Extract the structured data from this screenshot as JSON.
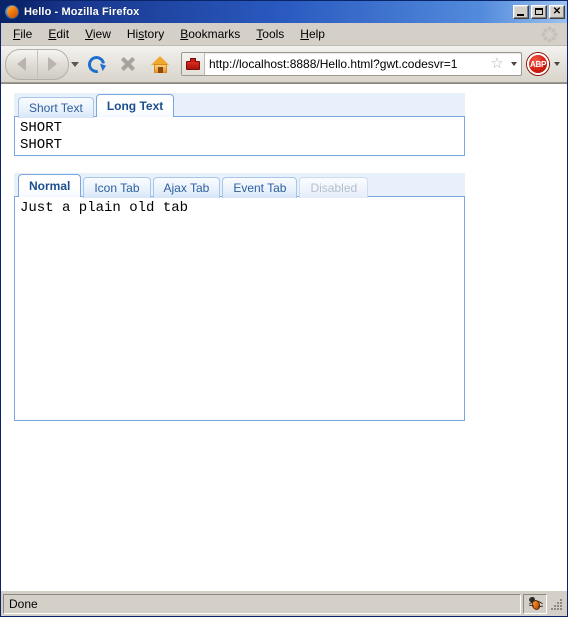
{
  "window": {
    "title": "Hello - Mozilla Firefox",
    "icon": "firefox-icon",
    "minimize_label": "–",
    "maximize_label": "□",
    "close_label": "✕"
  },
  "menubar": {
    "items": [
      {
        "pre": "",
        "key": "F",
        "post": "ile",
        "name": "menu-file"
      },
      {
        "pre": "",
        "key": "E",
        "post": "dit",
        "name": "menu-edit"
      },
      {
        "pre": "",
        "key": "V",
        "post": "iew",
        "name": "menu-view"
      },
      {
        "pre": "Hi",
        "key": "s",
        "post": "tory",
        "name": "menu-history"
      },
      {
        "pre": "",
        "key": "B",
        "post": "ookmarks",
        "name": "menu-bookmarks"
      },
      {
        "pre": "",
        "key": "T",
        "post": "ools",
        "name": "menu-tools"
      },
      {
        "pre": "",
        "key": "H",
        "post": "elp",
        "name": "menu-help"
      }
    ]
  },
  "toolbar": {
    "back_title": "Back",
    "forward_title": "Forward",
    "reload_title": "Reload",
    "stop_title": "Stop",
    "home_title": "Home",
    "abp_label": "ABP"
  },
  "urlbar": {
    "value": "http://localhost:8888/Hello.html?gwt.codesvr=1",
    "placeholder": "Go to a Web Site",
    "favicon": "toolbox-icon",
    "star": "☆"
  },
  "tabpanels": [
    {
      "name": "short-long-tabpanel",
      "tabs": [
        {
          "label": "Short Text",
          "state": "normal"
        },
        {
          "label": "Long Text",
          "state": "selected"
        }
      ],
      "content": "SHORT\nSHORT"
    },
    {
      "name": "main-tabpanel",
      "tabs": [
        {
          "label": "Normal",
          "state": "selected"
        },
        {
          "label": "Icon Tab",
          "state": "normal"
        },
        {
          "label": "Ajax Tab",
          "state": "normal"
        },
        {
          "label": "Event Tab",
          "state": "normal"
        },
        {
          "label": "Disabled",
          "state": "disabled"
        }
      ],
      "content": "Just a plain old tab"
    }
  ],
  "statusbar": {
    "text": "Done",
    "bug_icon": "firebug-icon"
  },
  "colors": {
    "titlebar_start": "#0a246a",
    "titlebar_end": "#9dc3f0",
    "chrome": "#d4d0c8",
    "tab_border": "#7ba7db",
    "tab_text": "#2d5f9e",
    "tab_selected_text": "#1b4f8f",
    "tab_disabled_text": "#b3bfcd",
    "tabbar_bg": "#e8f1fb"
  }
}
